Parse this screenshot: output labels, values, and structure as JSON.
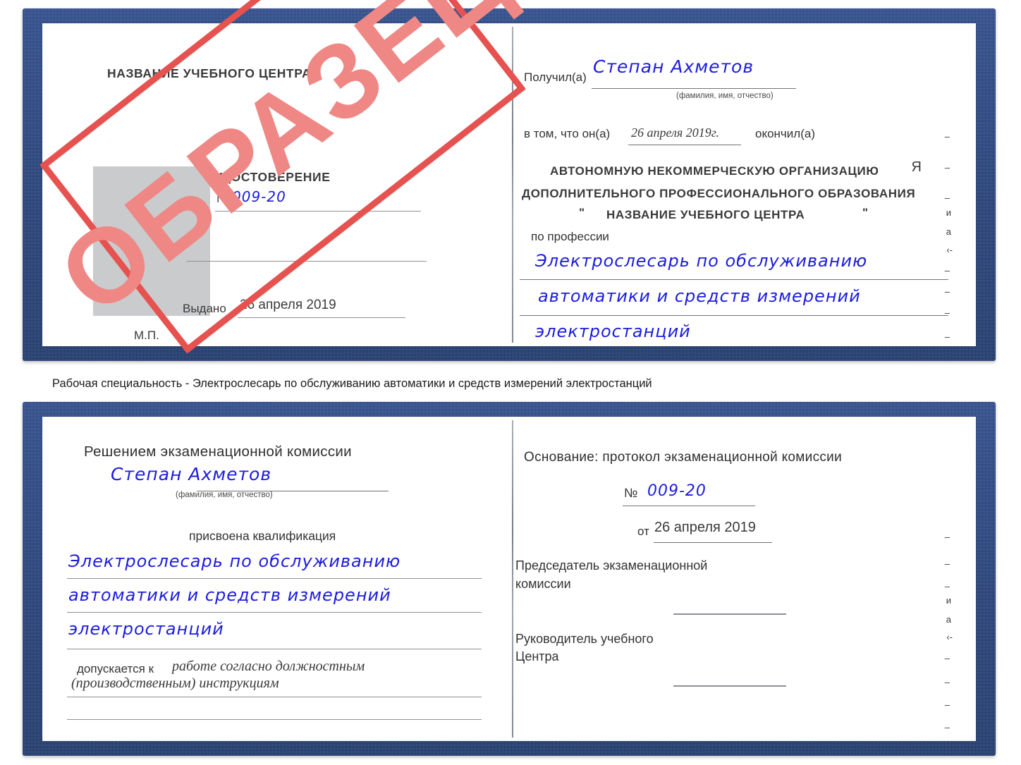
{
  "caption": "Рабочая специальность - Электрослесарь по обслуживанию автоматики и средств измерений электростанций",
  "stamp": {
    "text": "ОБРАЗЕЦ",
    "border_color": "#e6524f",
    "text_color": "#ef8785"
  },
  "colors": {
    "cover_blue": "#26478d",
    "handwriting_blue": "#1c1ce0",
    "page_white": "#ffffff",
    "rule_gray": "#8d9096",
    "photo_gray": "#c9cbcd"
  },
  "certificate_top": {
    "left_page": {
      "heading": "НАЗВАНИЕ УЧЕБНОГО ЦЕНТРА",
      "doc_type": "УДОСТОВЕРЕНИЕ",
      "number_label": "№",
      "number_value": "009-20",
      "issued_label": "Выдано",
      "issued_value": "26 апреля 2019",
      "seal_label": "М.П.",
      "photo_placeholder": "photo-placeholder"
    },
    "right_page": {
      "received_label": "Получил(а)",
      "received_value": "Степан Ахметов",
      "fio_hint": "(фамилия, имя, отчество)",
      "in_that_label": "в том, что он(а)",
      "in_that_value": "26 апреля 2019г.",
      "graduated_label": "окончил(а)",
      "org_line1": "АВТОНОМНУЮ НЕКОММЕРЧЕСКУЮ ОРГАНИЗАЦИЮ",
      "org_line2": "ДОПОЛНИТЕЛЬНОГО ПРОФЕССИОНАЛЬНОГО ОБРАЗОВАНИЯ",
      "org_quote_open": "\"",
      "org_line3": "НАЗВАНИЕ УЧЕБНОГО ЦЕНТРА",
      "org_quote_close": "\"",
      "profession_label": "по профессии",
      "profession_line1": "Электрослесарь по обслуживанию",
      "profession_line2": "автоматики и средств измерений",
      "profession_line3": "электростанций",
      "edge_marks": [
        "–",
        "–",
        "–",
        "и",
        "а",
        "‹-",
        "–",
        "–",
        "–",
        "–"
      ],
      "edge_letter": "Я"
    }
  },
  "certificate_bottom": {
    "left_page": {
      "heading": "Решением экзаменационной комиссии",
      "name_value": "Степан Ахметов",
      "fio_hint": "(фамилия, имя, отчество)",
      "qualification_label": "присвоена квалификация",
      "qualification_line1": "Электрослесарь по обслуживанию",
      "qualification_line2": "автоматики и средств измерений",
      "qualification_line3": "электростанций",
      "admitted_label": "допускается к",
      "admitted_value_line1": "работе согласно должностным",
      "admitted_value_line2": "(производственным) инструкциям"
    },
    "right_page": {
      "basis_label": "Основание: протокол экзаменационной комиссии",
      "number_label": "№",
      "number_value": "009-20",
      "date_label": "от",
      "date_value": "26 апреля 2019",
      "chairman_line1": "Председатель экзаменационной",
      "chairman_line2": "комиссии",
      "head_line1": "Руководитель учебного",
      "head_line2": "Центра",
      "edge_marks": [
        "–",
        "–",
        "–",
        "и",
        "а",
        "‹-",
        "–",
        "–",
        "–",
        "–"
      ]
    }
  }
}
